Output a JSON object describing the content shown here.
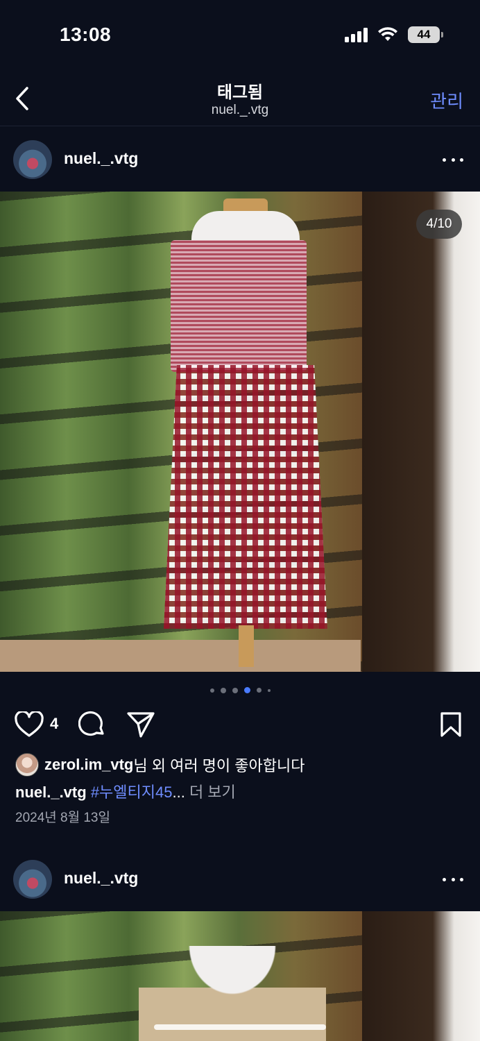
{
  "status_bar": {
    "time": "13:08",
    "battery": "44"
  },
  "nav": {
    "title": "태그됨",
    "subtitle": "nuel._.vtg",
    "manage_label": "관리"
  },
  "posts": [
    {
      "username": "nuel._.vtg",
      "photo_counter": "4/10",
      "like_count": "4",
      "likes_user": "zerol.im_vtg",
      "likes_suffix": "님 외 여러 명이 좋아합니다",
      "caption_user": "nuel._.vtg",
      "caption_hashtag": "#누엘티지45",
      "caption_ellipsis": "...",
      "caption_more": "더 보기",
      "date": "2024년 8월 13일"
    },
    {
      "username": "nuel._.vtg"
    }
  ],
  "icons": {
    "back": "chevron-left-icon",
    "more": "more-horizontal-icon",
    "like": "heart-icon",
    "comment": "comment-icon",
    "share": "send-icon",
    "save": "bookmark-icon"
  },
  "colors": {
    "background": "#0b0f1c",
    "accent": "#6f8dff",
    "muted": "#a3a7b2"
  }
}
